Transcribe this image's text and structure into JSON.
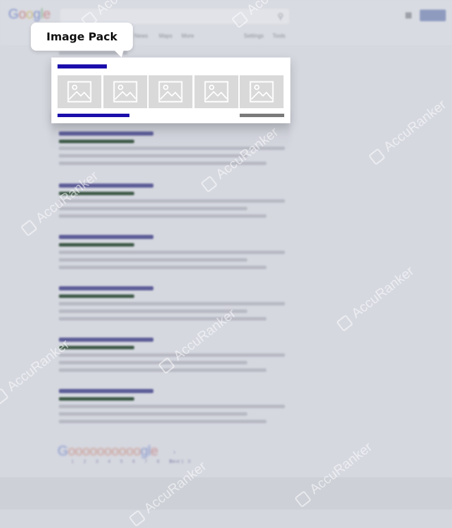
{
  "header": {
    "logo_letters": [
      "G",
      "o",
      "o",
      "g",
      "l",
      "e"
    ],
    "search_icon": "search-icon",
    "nav_tabs": [
      "News",
      "Maps",
      "More",
      "Settings",
      "Tools"
    ]
  },
  "callout": {
    "label": "Image Pack"
  },
  "image_pack": {
    "thumbnail_icon": "image-placeholder-icon",
    "thumbnail_count": 5
  },
  "watermark": {
    "text": "AccuRanker"
  },
  "footer": {
    "logo_g": "G",
    "logo_os": "oooooooooo",
    "logo_end_g": "g",
    "logo_l": "l",
    "logo_e": "e",
    "pages": "1 2 3 4 5 6 7 8 9 10",
    "next": "Next",
    "next_arrow": "›"
  },
  "colors": {
    "link_blue": "#1a0dab",
    "thumbnail_gray": "#d9d9d9",
    "background": "#d6d8e0"
  }
}
